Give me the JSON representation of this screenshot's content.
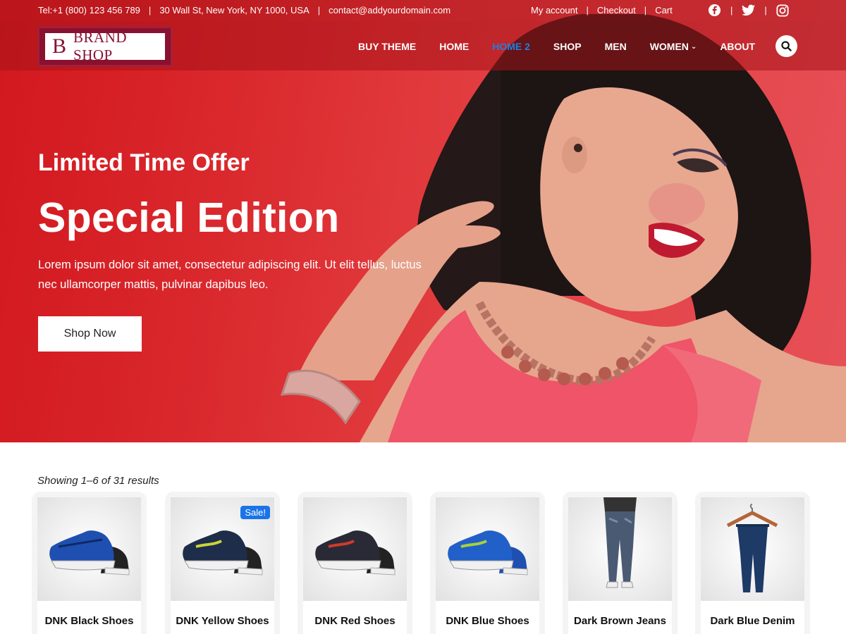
{
  "topbar": {
    "phone": "Tel:+1 (800) 123 456 789",
    "address": "30 Wall St, New York, NY 1000, USA",
    "email": "contact@addyourdomain.com",
    "links": [
      "My account",
      "Checkout",
      "Cart"
    ],
    "social_icons": [
      "facebook-icon",
      "twitter-icon",
      "instagram-icon"
    ]
  },
  "logo": {
    "mark": "B",
    "text": "BRAND SHOP"
  },
  "nav": {
    "items": [
      "BUY THEME",
      "HOME",
      "HOME 2",
      "SHOP",
      "MEN",
      "WOMEN",
      "ABOUT"
    ],
    "active": "HOME 2",
    "search_icon": "search-icon"
  },
  "hero": {
    "kicker": "Limited Time Offer",
    "title": "Special Edition",
    "description": "Lorem ipsum dolor sit amet, consectetur adipiscing elit. Ut elit tellus, luctus nec ullamcorper mattis, pulvinar dapibus leo.",
    "button": "Shop Now"
  },
  "shop": {
    "results_text": "Showing 1–6 of 31 results",
    "products": [
      {
        "name": "DNK Black Shoes",
        "badge": ""
      },
      {
        "name": "DNK Yellow Shoes",
        "badge": "Sale!"
      },
      {
        "name": "DNK Red Shoes",
        "badge": ""
      },
      {
        "name": "DNK Blue Shoes",
        "badge": ""
      },
      {
        "name": "Dark Brown Jeans",
        "badge": ""
      },
      {
        "name": "Dark Blue Denim",
        "badge": ""
      }
    ]
  },
  "colors": {
    "hero_red": "#e03238",
    "active_nav": "#1f7fe0",
    "sale_badge": "#1a73e8",
    "logo_bg": "#8a1030"
  }
}
